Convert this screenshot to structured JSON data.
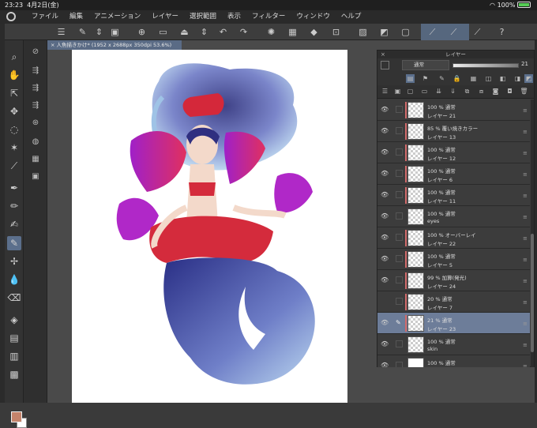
{
  "status": {
    "time": "23:23",
    "date": "4月2日(金)",
    "battery": "100%"
  },
  "menu": [
    "ファイル",
    "編集",
    "アニメーション",
    "レイヤー",
    "選択範囲",
    "表示",
    "フィルター",
    "ウィンドウ",
    "ヘルプ"
  ],
  "document_tab": "人魚描きかけ* (1952 x 2688px 350dpi 53.6%)",
  "layer_panel": {
    "title": "レイヤー",
    "blend_mode": "通常",
    "opacity": "21",
    "layers": [
      {
        "mode": "100 % 通常",
        "name": "レイヤー 21",
        "clip": true,
        "visible": true,
        "selected": false,
        "thumb": "checker"
      },
      {
        "mode": "85 % 覆い焼きカラー",
        "name": "レイヤー 13",
        "clip": true,
        "visible": true,
        "selected": false,
        "thumb": "checker"
      },
      {
        "mode": "100 % 通常",
        "name": "レイヤー 12",
        "clip": true,
        "visible": true,
        "selected": false,
        "thumb": "checker"
      },
      {
        "mode": "100 % 通常",
        "name": "レイヤー 6",
        "clip": true,
        "visible": true,
        "selected": false,
        "thumb": "checker"
      },
      {
        "mode": "100 % 通常",
        "name": "レイヤー 11",
        "clip": true,
        "visible": true,
        "selected": false,
        "thumb": "checker"
      },
      {
        "mode": "100 % 通常",
        "name": "eyes",
        "clip": false,
        "visible": true,
        "selected": false,
        "thumb": "checker"
      },
      {
        "mode": "100 % オーバーレイ",
        "name": "レイヤー 22",
        "clip": true,
        "visible": true,
        "selected": false,
        "thumb": "checker"
      },
      {
        "mode": "100 % 通常",
        "name": "レイヤー 5",
        "clip": true,
        "visible": true,
        "selected": false,
        "thumb": "checker"
      },
      {
        "mode": "99 % 加算(発光)",
        "name": "レイヤー 24",
        "clip": true,
        "visible": true,
        "selected": false,
        "thumb": "checker"
      },
      {
        "mode": "20 % 通常",
        "name": "レイヤー 7",
        "clip": true,
        "visible": false,
        "selected": false,
        "thumb": "checker"
      },
      {
        "mode": "21 % 通常",
        "name": "レイヤー 23",
        "clip": true,
        "visible": true,
        "selected": true,
        "thumb": "checker"
      },
      {
        "mode": "100 % 通常",
        "name": "skin",
        "clip": false,
        "visible": true,
        "selected": false,
        "thumb": "checker"
      },
      {
        "mode": "100 % 通常",
        "name": "",
        "clip": false,
        "visible": true,
        "selected": false,
        "thumb": "white"
      }
    ]
  },
  "colors": {
    "main": "#c4836b",
    "sub": "#ffffff",
    "accent": "#5b6f8c"
  }
}
